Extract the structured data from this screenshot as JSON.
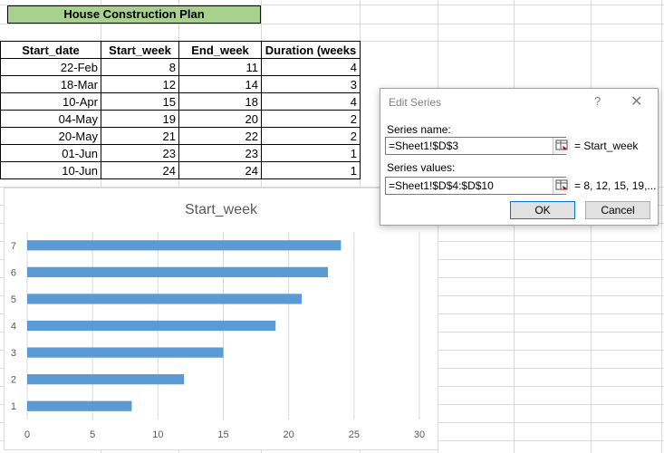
{
  "sheet": {
    "title": "House Construction Plan",
    "headers": [
      "Start_date",
      "Start_week",
      "End_week",
      "Duration (weeks"
    ],
    "rows": [
      [
        "22-Feb",
        "8",
        "11",
        "4"
      ],
      [
        "18-Mar",
        "12",
        "14",
        "3"
      ],
      [
        "10-Apr",
        "15",
        "18",
        "4"
      ],
      [
        "04-May",
        "19",
        "20",
        "2"
      ],
      [
        "20-May",
        "21",
        "22",
        "2"
      ],
      [
        "01-Jun",
        "23",
        "23",
        "1"
      ],
      [
        "10-Jun",
        "24",
        "24",
        "1"
      ]
    ]
  },
  "chart_data": {
    "type": "bar",
    "orientation": "horizontal",
    "title": "Start_week",
    "categories": [
      "1",
      "2",
      "3",
      "4",
      "5",
      "6",
      "7"
    ],
    "series": [
      {
        "name": "Start_week",
        "values": [
          8,
          12,
          15,
          19,
          21,
          23,
          24
        ]
      }
    ],
    "xlim": [
      0,
      30
    ],
    "xticks": [
      "0",
      "5",
      "10",
      "15",
      "20",
      "25",
      "30"
    ],
    "grid": "vertical",
    "bar_color": "#5b9bd5"
  },
  "dialog": {
    "title": "Edit Series",
    "help": "?",
    "close": "✕",
    "series_name_label": "Series name:",
    "series_name_value": "=Sheet1!$D$3",
    "series_name_preview": "= Start_week",
    "series_values_label": "Series values:",
    "series_values_value": "=Sheet1!$D$4:$D$10",
    "series_values_preview": "= 8, 12, 15, 19,...",
    "ok_label": "OK",
    "cancel_label": "Cancel"
  }
}
